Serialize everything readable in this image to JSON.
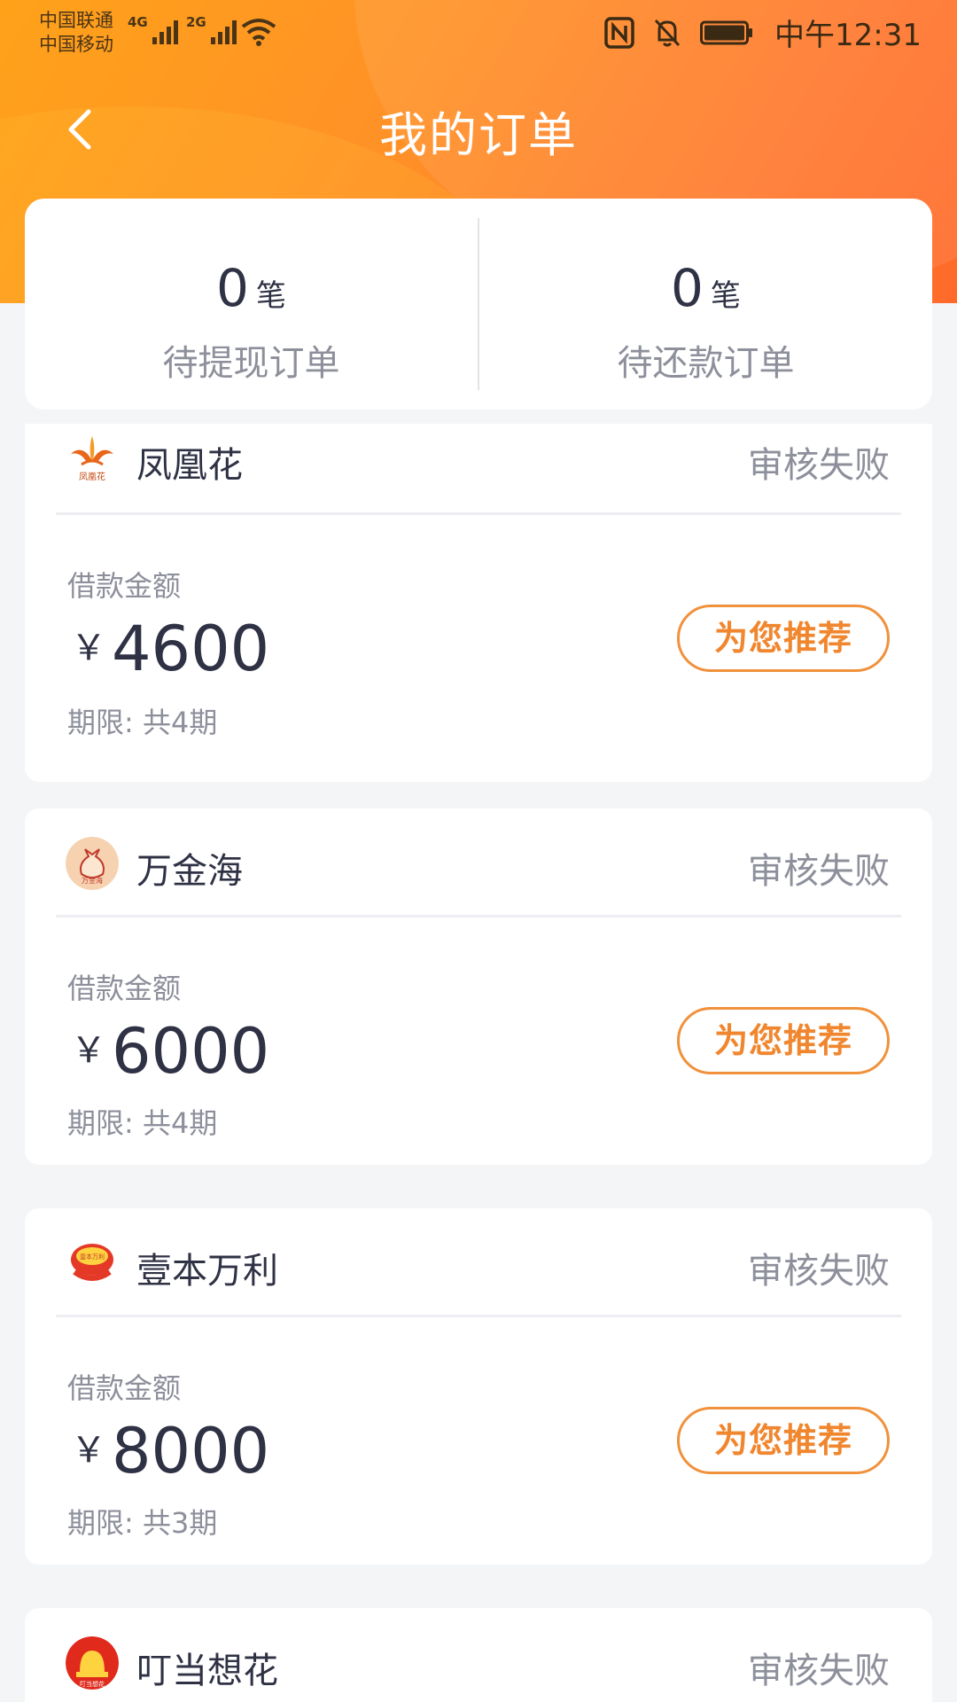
{
  "status_bar": {
    "carrier1": "中国联通",
    "carrier2": "中国移动",
    "sig1_tag": "4G",
    "sig2_tag": "2G",
    "time": "中午12:31"
  },
  "header": {
    "title": "我的订单"
  },
  "summary": {
    "withdraw": {
      "count": "0",
      "unit": "笔",
      "label": "待提现订单"
    },
    "repay": {
      "count": "0",
      "unit": "笔",
      "label": "待还款订单"
    }
  },
  "orders": [
    {
      "name": "凤凰花",
      "status": "审核失败",
      "amount_label": "借款金额",
      "currency": "￥",
      "amount": "4600",
      "term": "期限: 共4期",
      "button": "为您推荐",
      "logo_text": "凤凰花"
    },
    {
      "name": "万金海",
      "status": "审核失败",
      "amount_label": "借款金额",
      "currency": "￥",
      "amount": "6000",
      "term": "期限: 共4期",
      "button": "为您推荐",
      "logo_text": "万金海"
    },
    {
      "name": "壹本万利",
      "status": "审核失败",
      "amount_label": "借款金额",
      "currency": "￥",
      "amount": "8000",
      "term": "期限: 共3期",
      "button": "为您推荐",
      "logo_text": "壹本万利"
    },
    {
      "name": "叮当想花",
      "status": "审核失败",
      "logo_text": "叮当想花"
    }
  ],
  "colors": {
    "accent": "#f0862e",
    "header_start": "#ffa21a",
    "header_end": "#ff6a2a",
    "text_primary": "#2f3244",
    "text_secondary": "#8d8f9b"
  }
}
